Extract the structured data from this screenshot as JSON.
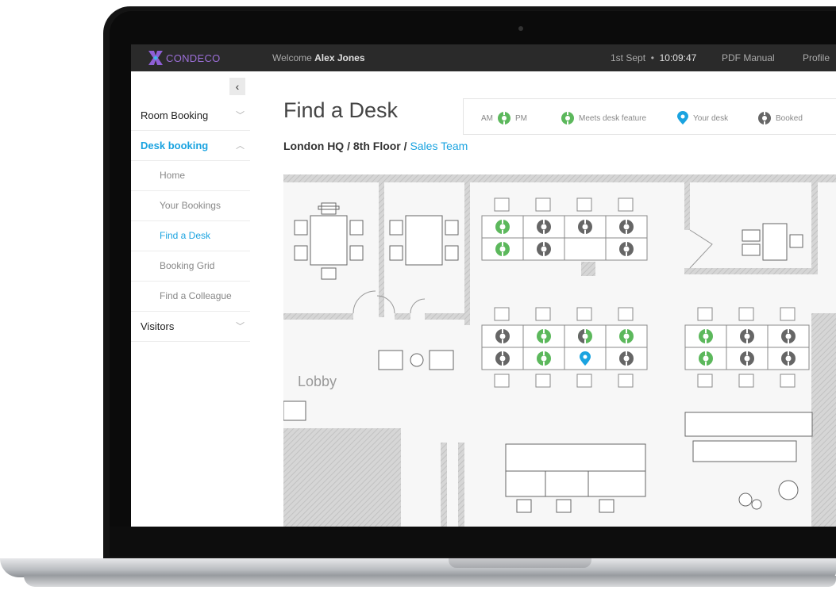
{
  "app": {
    "brand": "CONDECO"
  },
  "topbar": {
    "welcome_prefix": "Welcome",
    "user_name": "Alex Jones",
    "date": "1st Sept",
    "time": "10:09:47",
    "pdf_manual": "PDF Manual",
    "profile": "Profile"
  },
  "sidebar": {
    "collapse_icon": "chevron-left-icon",
    "items": [
      {
        "label": "Room Booking"
      },
      {
        "label": "Desk booking"
      },
      {
        "label": "Visitors"
      }
    ],
    "sub_items": [
      {
        "label": "Home"
      },
      {
        "label": "Your Bookings"
      },
      {
        "label": "Find a Desk"
      },
      {
        "label": "Booking Grid"
      },
      {
        "label": "Find a Colleague"
      }
    ]
  },
  "main": {
    "title": "Find a Desk",
    "breadcrumb": {
      "location": "London HQ",
      "floor": "8th Floor",
      "team": "Sales Team",
      "separator": "/"
    }
  },
  "legend": {
    "am": "AM",
    "pm": "PM",
    "meets_feature": "Meets desk feature",
    "your_desk": "Your desk",
    "booked": "Booked"
  },
  "floorplan": {
    "lobby_label": "Lobby",
    "colors": {
      "green": "#5cb85c",
      "blue": "#1aa3e0",
      "gray": "#666666"
    }
  }
}
